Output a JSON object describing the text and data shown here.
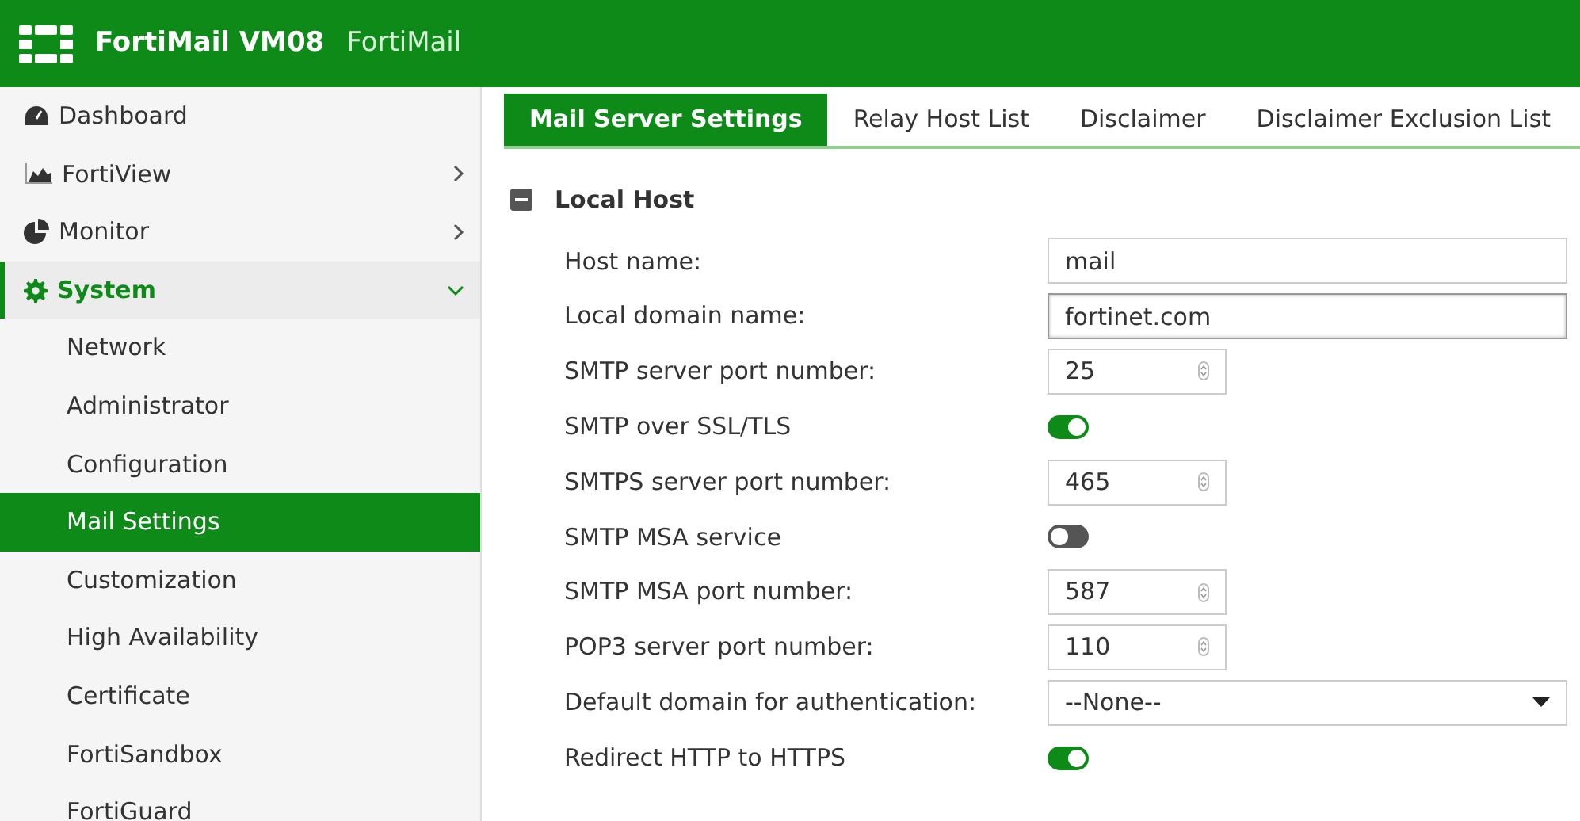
{
  "header": {
    "product": "FortiMail VM08",
    "host": "FortiMail"
  },
  "sidebar": {
    "items": [
      {
        "label": "Dashboard",
        "expandable": false,
        "expanded": false
      },
      {
        "label": "FortiView",
        "expandable": true,
        "expanded": false
      },
      {
        "label": "Monitor",
        "expandable": true,
        "expanded": false
      },
      {
        "label": "System",
        "expandable": true,
        "expanded": true,
        "children": [
          {
            "label": "Network",
            "selected": false
          },
          {
            "label": "Administrator",
            "selected": false
          },
          {
            "label": "Configuration",
            "selected": false
          },
          {
            "label": "Mail Settings",
            "selected": true
          },
          {
            "label": "Customization",
            "selected": false
          },
          {
            "label": "High Availability",
            "selected": false
          },
          {
            "label": "Certificate",
            "selected": false
          },
          {
            "label": "FortiSandbox",
            "selected": false
          },
          {
            "label": "FortiGuard",
            "selected": false
          }
        ]
      }
    ]
  },
  "tabs": [
    {
      "label": "Mail Server Settings",
      "selected": true
    },
    {
      "label": "Relay Host List",
      "selected": false
    },
    {
      "label": "Disclaimer",
      "selected": false
    },
    {
      "label": "Disclaimer Exclusion List",
      "selected": false
    }
  ],
  "section": {
    "title": "Local Host",
    "expanded": true,
    "fields": [
      {
        "kind": "text",
        "label": "Host name:",
        "value": "mail",
        "focused": false
      },
      {
        "kind": "text",
        "label": "Local domain name:",
        "value": "fortinet.com",
        "focused": true
      },
      {
        "kind": "number",
        "label": "SMTP server port number:",
        "value": "25"
      },
      {
        "kind": "toggle",
        "label": "SMTP over SSL/TLS",
        "on": true
      },
      {
        "kind": "number",
        "label": "SMTPS server port number:",
        "value": "465"
      },
      {
        "kind": "toggle",
        "label": "SMTP MSA service",
        "on": false
      },
      {
        "kind": "number",
        "label": "SMTP MSA port number:",
        "value": "587"
      },
      {
        "kind": "number",
        "label": "POP3 server port number:",
        "value": "110"
      },
      {
        "kind": "select",
        "label": "Default domain for authentication:",
        "value": "--None--"
      },
      {
        "kind": "toggle",
        "label": "Redirect HTTP to HTTPS",
        "on": true
      }
    ]
  }
}
